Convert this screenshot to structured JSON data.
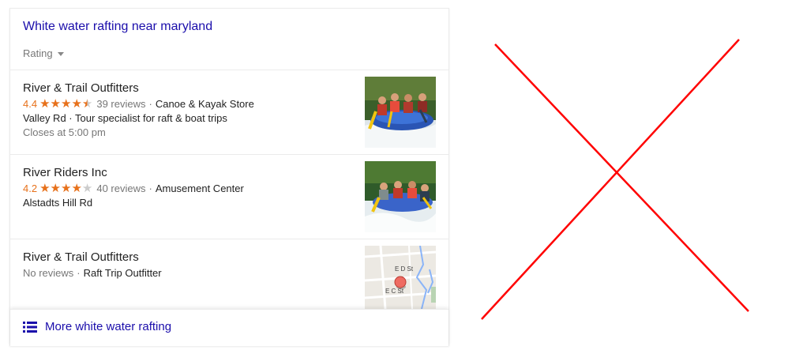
{
  "panel": {
    "title": "White water rafting near maryland",
    "filter_label": "Rating"
  },
  "results": [
    {
      "name": "River & Trail Outfitters",
      "rating": "4.4",
      "stars_filled": 4.5,
      "reviews": "39 reviews",
      "separator": "·",
      "category": "Canoe & Kayak Store",
      "address_line": "Valley Rd · Tour specialist for raft & boat trips",
      "hours": "Closes at 5:00 pm"
    },
    {
      "name": "River Riders Inc",
      "rating": "4.2",
      "stars_filled": 4,
      "reviews": "40 reviews",
      "separator": "·",
      "category": "Amusement Center",
      "address_line": "Alstadts Hill Rd"
    },
    {
      "name": "River & Trail Outfitters",
      "reviews": "No reviews",
      "separator": "·",
      "category": "Raft Trip Outfitter",
      "map_labels": [
        "E D St",
        "E C St"
      ]
    }
  ],
  "more_link": "More white water rafting",
  "colors": {
    "link": "#1a0dab",
    "rating": "#e7711b",
    "muted": "#777777",
    "cross": "#ff0000"
  },
  "icons": [
    "caret-down-icon",
    "star-icon",
    "list-icon",
    "map-pin-icon"
  ]
}
